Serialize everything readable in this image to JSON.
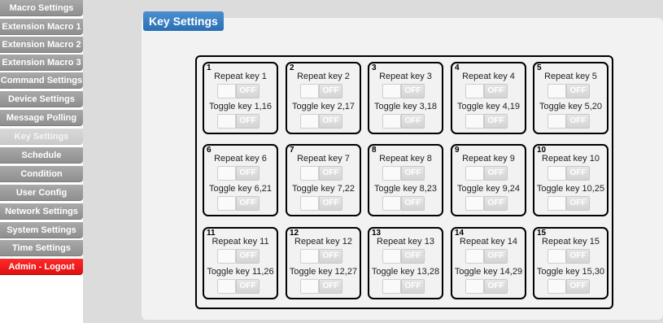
{
  "sidebar": {
    "items": [
      {
        "label": "Macro Settings",
        "state": "normal"
      },
      {
        "label": "Extension Macro 1",
        "state": "normal"
      },
      {
        "label": "Extension Macro 2",
        "state": "normal"
      },
      {
        "label": "Extension Macro 3",
        "state": "normal"
      },
      {
        "label": "Command Settings",
        "state": "normal"
      },
      {
        "label": "Device Settings",
        "state": "normal"
      },
      {
        "label": "Message Polling",
        "state": "normal"
      },
      {
        "label": "Key Settings",
        "state": "active"
      },
      {
        "label": "Schedule",
        "state": "normal"
      },
      {
        "label": "Condition",
        "state": "normal"
      },
      {
        "label": "User Config",
        "state": "normal"
      },
      {
        "label": "Network Settings",
        "state": "normal"
      },
      {
        "label": "System Settings",
        "state": "normal"
      },
      {
        "label": "Time Settings",
        "state": "normal"
      },
      {
        "label": "Admin - Logout",
        "state": "logout"
      }
    ]
  },
  "panel": {
    "title": "Key Settings"
  },
  "toggle_off_label": "OFF",
  "keys": [
    {
      "number": "1",
      "repeat_label": "Repeat key 1",
      "toggle_label": "Toggle key 1,16",
      "repeat_state": "OFF",
      "toggle_state": "OFF"
    },
    {
      "number": "2",
      "repeat_label": "Repeat key 2",
      "toggle_label": "Toggle key 2,17",
      "repeat_state": "OFF",
      "toggle_state": "OFF"
    },
    {
      "number": "3",
      "repeat_label": "Repeat key 3",
      "toggle_label": "Toggle key 3,18",
      "repeat_state": "OFF",
      "toggle_state": "OFF"
    },
    {
      "number": "4",
      "repeat_label": "Repeat key 4",
      "toggle_label": "Toggle key 4,19",
      "repeat_state": "OFF",
      "toggle_state": "OFF"
    },
    {
      "number": "5",
      "repeat_label": "Repeat key 5",
      "toggle_label": "Toggle key 5,20",
      "repeat_state": "OFF",
      "toggle_state": "OFF"
    },
    {
      "number": "6",
      "repeat_label": "Repeat key 6",
      "toggle_label": "Toggle key 6,21",
      "repeat_state": "OFF",
      "toggle_state": "OFF"
    },
    {
      "number": "7",
      "repeat_label": "Repeat key 7",
      "toggle_label": "Toggle key 7,22",
      "repeat_state": "OFF",
      "toggle_state": "OFF"
    },
    {
      "number": "8",
      "repeat_label": "Repeat key 8",
      "toggle_label": "Toggle key 8,23",
      "repeat_state": "OFF",
      "toggle_state": "OFF"
    },
    {
      "number": "9",
      "repeat_label": "Repeat key 9",
      "toggle_label": "Toggle key 9,24",
      "repeat_state": "OFF",
      "toggle_state": "OFF"
    },
    {
      "number": "10",
      "repeat_label": "Repeat key 10",
      "toggle_label": "Toggle key 10,25",
      "repeat_state": "OFF",
      "toggle_state": "OFF"
    },
    {
      "number": "11",
      "repeat_label": "Repeat key 11",
      "toggle_label": "Toggle key 11,26",
      "repeat_state": "OFF",
      "toggle_state": "OFF"
    },
    {
      "number": "12",
      "repeat_label": "Repeat key 12",
      "toggle_label": "Toggle key 12,27",
      "repeat_state": "OFF",
      "toggle_state": "OFF"
    },
    {
      "number": "13",
      "repeat_label": "Repeat key 13",
      "toggle_label": "Toggle key 13,28",
      "repeat_state": "OFF",
      "toggle_state": "OFF"
    },
    {
      "number": "14",
      "repeat_label": "Repeat key 14",
      "toggle_label": "Toggle key 14,29",
      "repeat_state": "OFF",
      "toggle_state": "OFF"
    },
    {
      "number": "15",
      "repeat_label": "Repeat key 15",
      "toggle_label": "Toggle key 15,30",
      "repeat_state": "OFF",
      "toggle_state": "OFF"
    }
  ]
}
